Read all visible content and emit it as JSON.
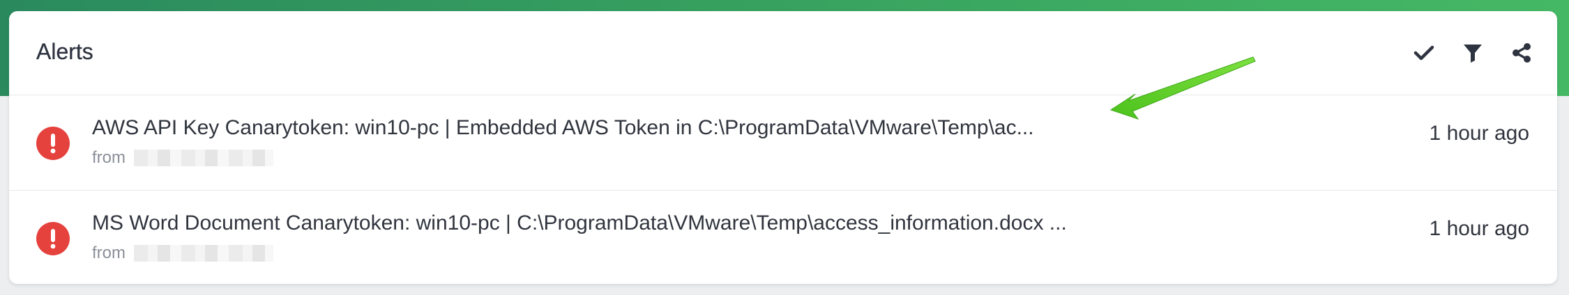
{
  "header": {
    "title": "Alerts",
    "actions": [
      {
        "name": "mark-all-read",
        "icon": "checkmark-icon"
      },
      {
        "name": "filter",
        "icon": "filter-icon"
      },
      {
        "name": "share",
        "icon": "share-icon"
      }
    ]
  },
  "alerts": [
    {
      "title": "AWS API Key Canarytoken: win10-pc | Embedded AWS Token in C:\\ProgramData\\VMware\\Temp\\ac...",
      "from_label": "from",
      "time": "1 hour ago",
      "icon": "exclamation-icon"
    },
    {
      "title": "MS Word Document Canarytoken: win10-pc | C:\\ProgramData\\VMware\\Temp\\access_information.docx ...",
      "from_label": "from",
      "time": "1 hour ago",
      "icon": "exclamation-icon"
    }
  ],
  "colors": {
    "alert_red": "#e5413d",
    "accent_green": "#36a05f",
    "annotation_arrow": "#5fd12a"
  }
}
